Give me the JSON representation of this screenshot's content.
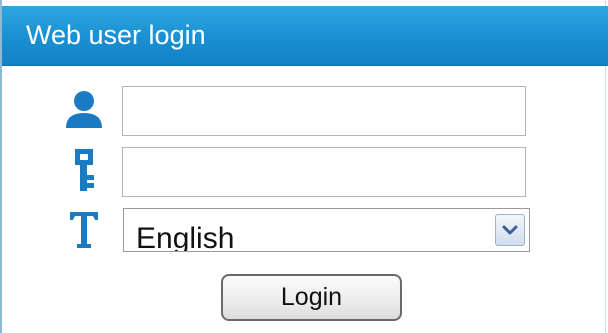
{
  "header": {
    "title": "Web user login"
  },
  "form": {
    "username": {
      "value": "",
      "icon": "user-icon"
    },
    "password": {
      "value": "",
      "icon": "key-icon"
    },
    "language": {
      "selected": "English",
      "icon": "language-icon"
    },
    "login_label": "Login"
  },
  "colors": {
    "header_bg": "#1a8fd2",
    "icon_blue": "#1a7bc2",
    "header_text": "#ffffff"
  }
}
